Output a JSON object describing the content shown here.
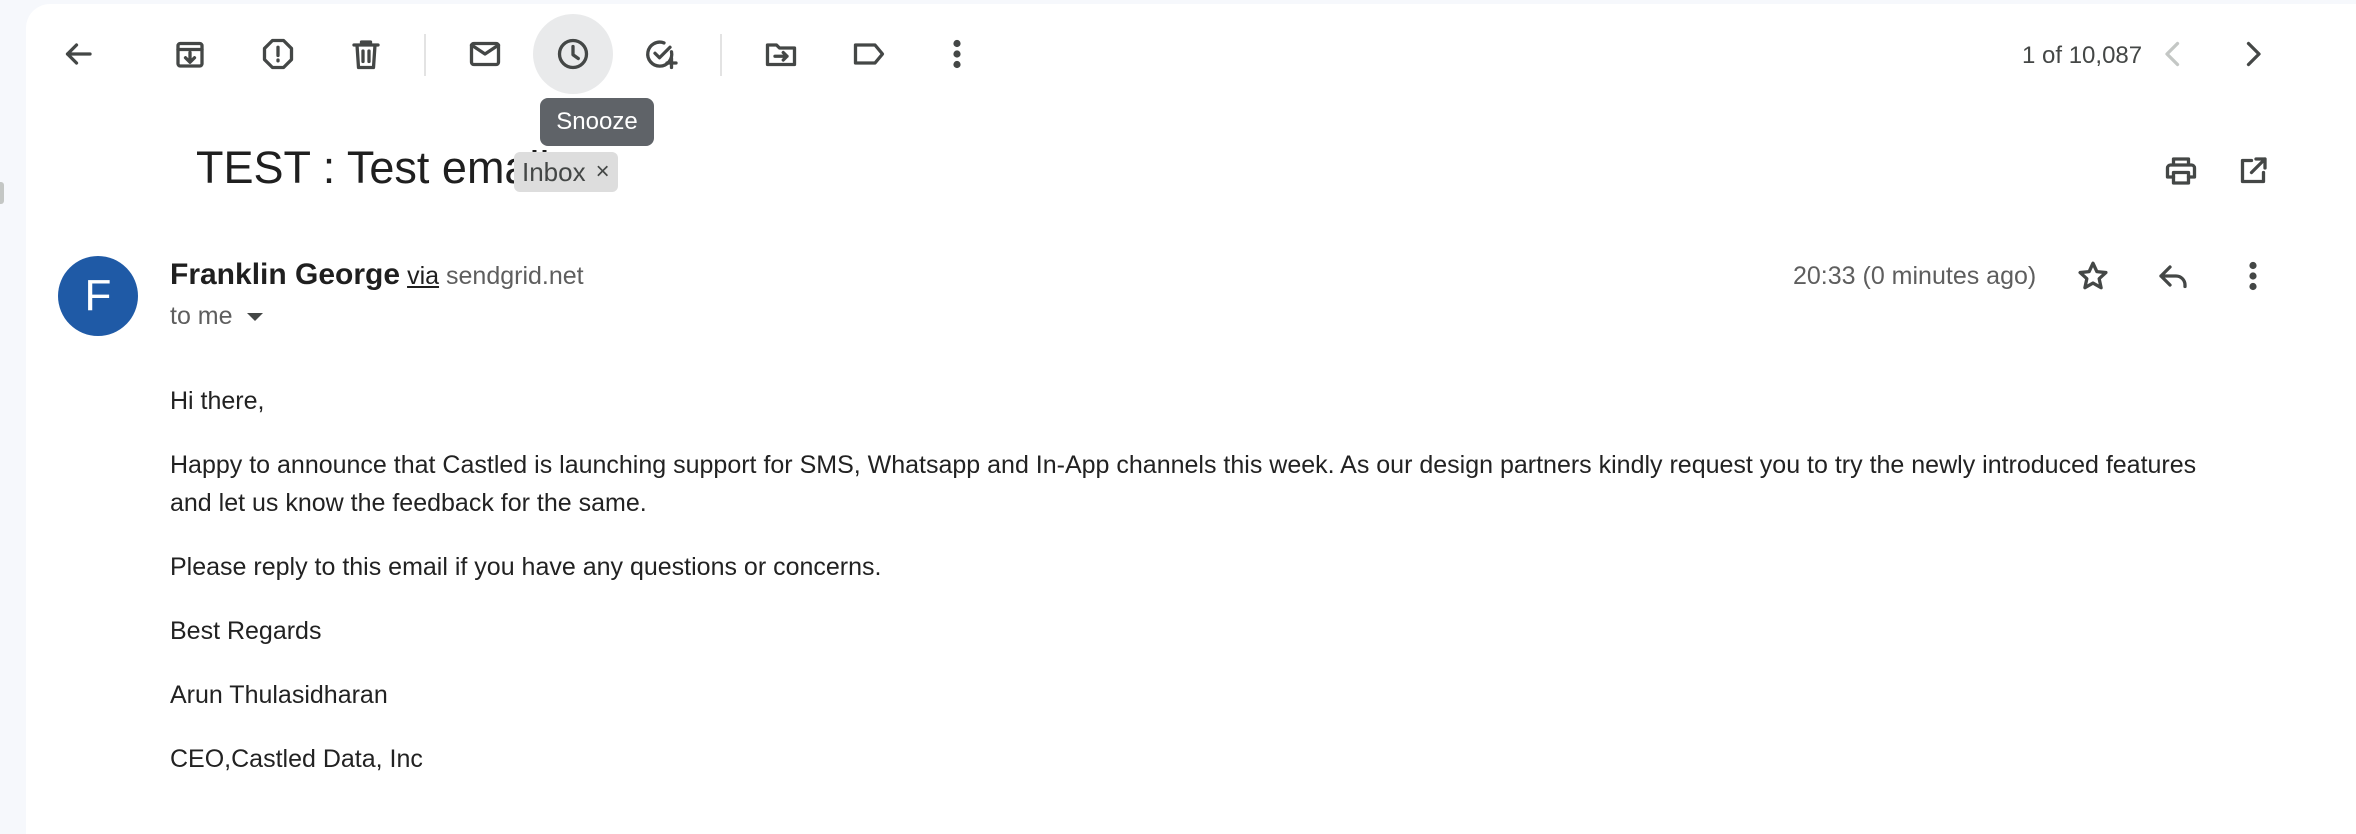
{
  "toolbar": {
    "back_label": "Back",
    "archive_label": "Archive",
    "report_spam_label": "Report spam",
    "delete_label": "Delete",
    "mark_unread_label": "Mark as unread",
    "snooze_label": "Snooze",
    "add_task_label": "Add to Tasks",
    "move_to_label": "Move to",
    "labels_label": "Labels",
    "more_label": "More"
  },
  "tooltip": {
    "text": "Snooze"
  },
  "pager": {
    "text": "1 of 10,087",
    "older_label": "Older",
    "newer_label": "Newer"
  },
  "email": {
    "subject": "TEST : Test email",
    "label_chip": "Inbox",
    "label_chip_remove": "×",
    "print_label": "Print all",
    "new_window_label": "In new window",
    "sender": {
      "initial": "F",
      "name": "Franklin George",
      "via": "via",
      "via_domain": "sendgrid.net",
      "avatar_color": "#1f5aa6"
    },
    "recipient": "to me",
    "timestamp": "20:33 (0 minutes ago)",
    "body": [
      "Hi there,",
      "Happy to announce that Castled is launching support for SMS, Whatsapp and In-App channels this week. As our design partners kindly request you to try the newly introduced features and let us know the feedback for the same.",
      "Please reply to this email if you have any questions or concerns.",
      "Best Regards",
      "Arun Thulasidharan",
      "CEO,Castled Data, Inc"
    ]
  }
}
